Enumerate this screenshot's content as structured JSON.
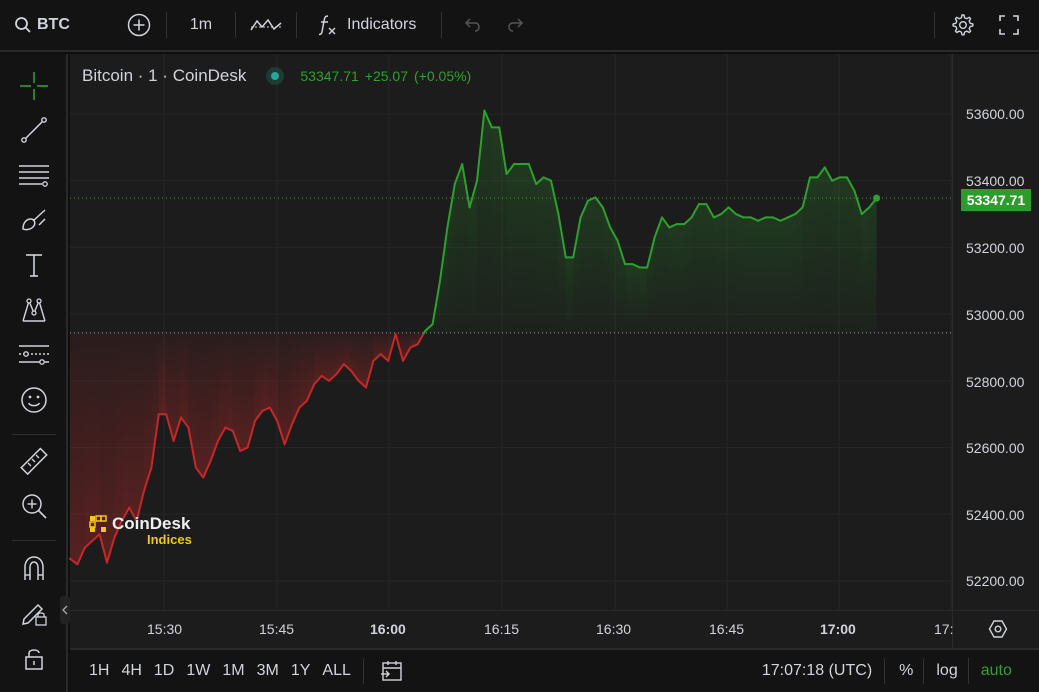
{
  "topbar": {
    "symbol": "BTC",
    "interval": "1m",
    "indicators_label": "Indicators"
  },
  "legend": {
    "title": "Bitcoin · 1 · CoinDesk",
    "last": "53347.71",
    "change": "+25.07",
    "change_pct": "(+0.05%)"
  },
  "price_axis": [
    "53600.00",
    "53400.00",
    "53200.00",
    "53000.00",
    "52800.00",
    "52600.00",
    "52400.00",
    "52200.00"
  ],
  "last_price_label": "53347.71",
  "time_axis": [
    "15:30",
    "15:45",
    "16:00",
    "16:15",
    "16:30",
    "16:45",
    "17:00",
    "17:"
  ],
  "time_axis_bold": [
    "16:00",
    "17:00"
  ],
  "logo": {
    "brand": "CoinDesk",
    "sub": "Indices"
  },
  "bottombar": {
    "ranges": [
      "1H",
      "4H",
      "1D",
      "1W",
      "1M",
      "3M",
      "1Y",
      "ALL"
    ],
    "clock": "17:07:18 (UTC)",
    "percent": "%",
    "log": "log",
    "auto": "auto"
  },
  "colors": {
    "up": "#2ea02e",
    "down": "#c62828",
    "auto": "#2ea02e",
    "background": "#1c1c1c"
  },
  "chart_data": {
    "type": "area",
    "baseline": 52944,
    "ylim": [
      52150,
      53700
    ],
    "x_start": "15:24",
    "x_step_minutes": 0.5,
    "values": [
      52267,
      52250,
      52300,
      52320,
      52340,
      52255,
      52330,
      52380,
      52420,
      52380,
      52470,
      52540,
      52700,
      52700,
      52620,
      52690,
      52660,
      52540,
      52510,
      52560,
      52620,
      52660,
      52650,
      52590,
      52600,
      52680,
      52710,
      52720,
      52680,
      52610,
      52670,
      52720,
      52740,
      52790,
      52815,
      52800,
      52820,
      52850,
      52830,
      52800,
      52780,
      52860,
      52880,
      52860,
      52940,
      52860,
      52900,
      52910,
      52950,
      52970,
      53100,
      53260,
      53390,
      53450,
      53320,
      53400,
      53610,
      53560,
      53560,
      53420,
      53450,
      53450,
      53450,
      53390,
      53410,
      53400,
      53300,
      53170,
      53170,
      53290,
      53340,
      53350,
      53320,
      53260,
      53220,
      53150,
      53150,
      53140,
      53140,
      53230,
      53290,
      53260,
      53270,
      53270,
      53290,
      53330,
      53330,
      53290,
      53300,
      53320,
      53300,
      53290,
      53290,
      53280,
      53290,
      53290,
      53280,
      53290,
      53300,
      53320,
      53410,
      53410,
      53440,
      53400,
      53410,
      53410,
      53370,
      53300,
      53320,
      53347.71
    ]
  }
}
